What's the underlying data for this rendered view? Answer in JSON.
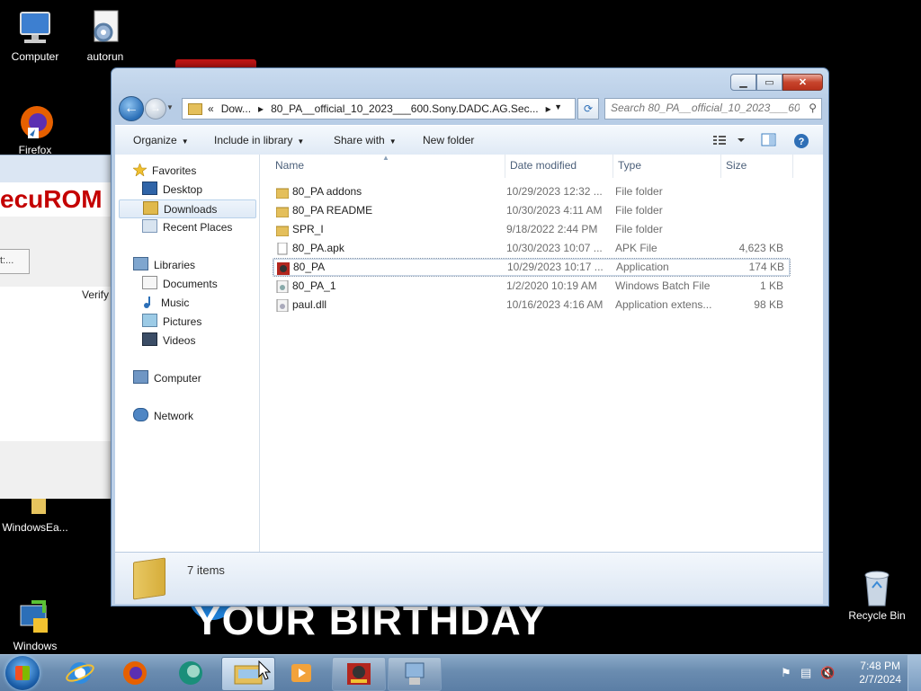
{
  "desktop": {
    "icons": [
      {
        "label": "Computer"
      },
      {
        "label": "autorun"
      },
      {
        "label": "Firefox"
      },
      {
        "label": "WindowsEa..."
      },
      {
        "label": "Windows\nEasy Transfer"
      },
      {
        "label": "Recycle Bin"
      }
    ],
    "wallpaper_text": "YOUR BIRTHDAY"
  },
  "background_window": {
    "banner": "ecuROM",
    "button_label": "t:...",
    "column_label": "Verify"
  },
  "explorer": {
    "address": {
      "chevron": "«",
      "crumbs": [
        "Dow...",
        "80_PA__official_10_2023___600.Sony.DADC.AG.Sec..."
      ]
    },
    "search_placeholder": "Search 80_PA__official_10_2023___600...",
    "toolbar": {
      "organize": "Organize",
      "include": "Include in library",
      "share": "Share with",
      "new_folder": "New folder"
    },
    "nav": {
      "favorites": "Favorites",
      "desktop": "Desktop",
      "downloads": "Downloads",
      "recent": "Recent Places",
      "libraries": "Libraries",
      "documents": "Documents",
      "music": "Music",
      "pictures": "Pictures",
      "videos": "Videos",
      "computer": "Computer",
      "network": "Network"
    },
    "columns": {
      "name": "Name",
      "date": "Date modified",
      "type": "Type",
      "size": "Size"
    },
    "files": [
      {
        "name": "80_PA addons",
        "date": "10/29/2023 12:32 ...",
        "type": "File folder",
        "size": "",
        "icon": "folder-icon"
      },
      {
        "name": "80_PA README",
        "date": "10/30/2023 4:11 AM",
        "type": "File folder",
        "size": "",
        "icon": "folder-icon"
      },
      {
        "name": "SPR_I",
        "date": "9/18/2022 2:44 PM",
        "type": "File folder",
        "size": "",
        "icon": "folder-icon"
      },
      {
        "name": "80_PA.apk",
        "date": "10/30/2023 10:07 ...",
        "type": "APK File",
        "size": "4,623 KB",
        "icon": "file-icon"
      },
      {
        "name": "80_PA",
        "date": "10/29/2023 10:17 ...",
        "type": "Application",
        "size": "174 KB",
        "icon": "app-icon"
      },
      {
        "name": "80_PA_1",
        "date": "1/2/2020 10:19 AM",
        "type": "Windows Batch File",
        "size": "1 KB",
        "icon": "batch-icon"
      },
      {
        "name": "paul.dll",
        "date": "10/16/2023 4:16 AM",
        "type": "Application extens...",
        "size": "98 KB",
        "icon": "dll-icon"
      }
    ],
    "status": "7 items"
  },
  "taskbar": {
    "time": "7:48 PM",
    "date": "2/7/2024"
  },
  "colors": {
    "accent": "#2b6fb7",
    "taskbar": "#6a8cb0",
    "folder": "#e4bf5b",
    "close": "#c7442c"
  }
}
